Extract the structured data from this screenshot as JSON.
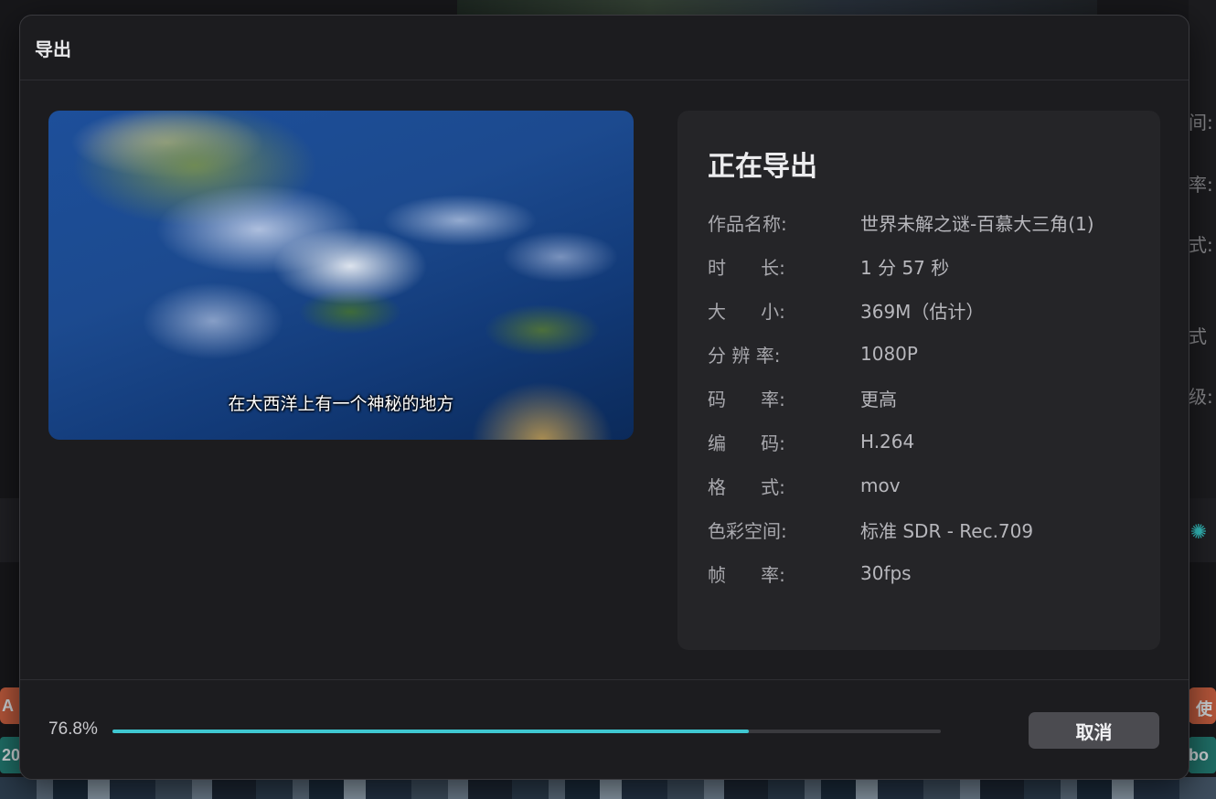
{
  "dialog": {
    "title": "导出"
  },
  "preview": {
    "subtitle": "在大西洋上有一个神秘的地方"
  },
  "info": {
    "heading": "正在导出",
    "rows": [
      {
        "label": "作品名称:",
        "value": "世界未解之谜-百慕大三角(1)"
      },
      {
        "label": "时      长:",
        "value": "1 分 57 秒"
      },
      {
        "label": "大      小:",
        "value": "369M（估计）"
      },
      {
        "label": "分 辨 率:",
        "value": "1080P"
      },
      {
        "label": "码      率:",
        "value": "更高"
      },
      {
        "label": "编      码:",
        "value": "H.264"
      },
      {
        "label": "格      式:",
        "value": "mov"
      },
      {
        "label": "色彩空间:",
        "value": "标准 SDR - Rec.709"
      },
      {
        "label": "帧      率:",
        "value": "30fps"
      }
    ]
  },
  "progress": {
    "percent_text": "76.8%",
    "fraction": 0.768,
    "color": "#3fc7d1"
  },
  "footer": {
    "cancel_label": "取消"
  },
  "background": {
    "right_fragments": [
      "间:",
      "率:",
      "式:",
      "式",
      "级:"
    ],
    "track_left_label": "A",
    "track_left_label2": "20",
    "track_right_label": "bo",
    "track_right_label2": "使"
  }
}
